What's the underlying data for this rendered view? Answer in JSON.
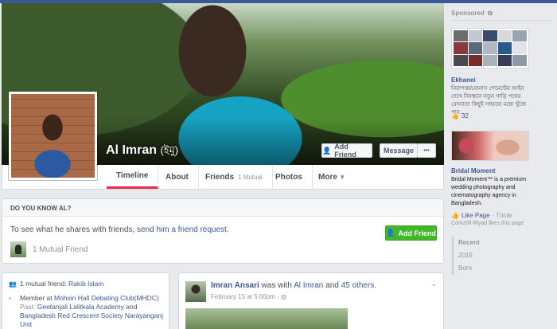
{
  "profile": {
    "name": "Al Imran",
    "name_native": "(ইমু)",
    "add_friend_label": "Add Friend",
    "message_label": "Message",
    "more_dots": "•••"
  },
  "tabs": [
    {
      "label": "Timeline"
    },
    {
      "label": "About"
    },
    {
      "label": "Friends",
      "sub": "1 Mutual"
    },
    {
      "label": "Photos"
    },
    {
      "label": "More",
      "chevron": "▾"
    }
  ],
  "know": {
    "heading": "DO YOU KNOW AL?",
    "text_before": "To see what he shares with friends, ",
    "text_link": "send him a friend request.",
    "add_friend_label": "Add Friend",
    "mutual_friends": "1 Mutual Friend"
  },
  "intro": {
    "mutual_prefix": "1 mutual friend: ",
    "mutual_name": "Rakib Islam",
    "member_prefix": "Member at ",
    "member_org": "Mohsin Hall Debating Club(MHDC)",
    "past_label": "Past: ",
    "past_org1": "Geetanjali Lalitkala Academy",
    "past_and": " and",
    "past_org2": "Bangladesh Red Crescent Society Narayanganj",
    "past_unit": "Unit"
  },
  "post": {
    "author": "Imran Ansari",
    "was_with": " was with ",
    "with_name": "Al Imran",
    "and": " and ",
    "others": "45 others.",
    "time": "February 15 at 5:00pm · ",
    "chevron": "⌄"
  },
  "sidebar": {
    "sponsored": "Sponsored",
    "sponsored_glyph": "⧉",
    "ad1_title": "Ekhanei",
    "ad1_text": "নিরাপত্তা/বোনাস পেমেন্টের আইন দেখে নিবন্ধনে নতুন গাড়ি পথের বেদনাতা কিছুই সাহায্যে মধ্যে খুঁজে পাব...",
    "ad1_likes": "32",
    "ad2_title": "Bridal Moment",
    "ad2_text": "Bridal Moment™ is a premium wedding photography and cinematography agency in Bangladesh.",
    "ad2_like": "Like Page",
    "ad2_like_sep": " · Tócár",
    "ad2_social": "Còrkzòll Riyad likes this page",
    "years": [
      "Recent",
      "2015",
      "Born"
    ]
  },
  "colors": {
    "facebook_blue": "#3b5998",
    "green_button": "#42b72a",
    "tab_active_underline": "#f02849"
  }
}
